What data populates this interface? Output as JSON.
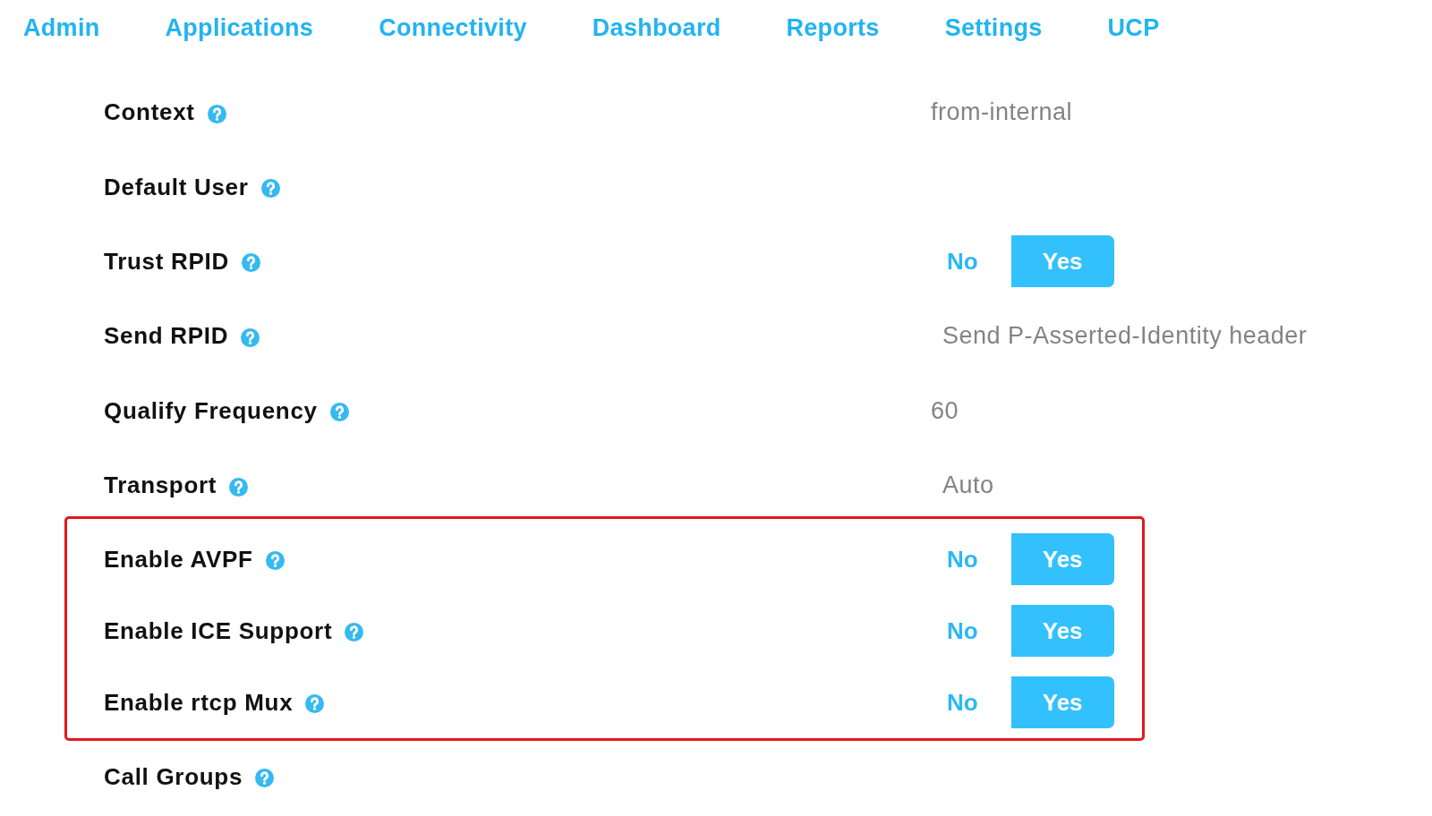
{
  "nav": [
    "Admin",
    "Applications",
    "Connectivity",
    "Dashboard",
    "Reports",
    "Settings",
    "UCP"
  ],
  "groups": [
    {
      "highlighted": false,
      "rows": [
        {
          "label": "Context",
          "kind": "text",
          "value": "from-internal"
        },
        {
          "label": "Default User",
          "kind": "text"
        },
        {
          "label": "Trust RPID",
          "kind": "toggle",
          "options": [
            {
              "label": "No",
              "selected": false
            },
            {
              "label": "Yes",
              "selected": true
            }
          ]
        },
        {
          "label": "Send RPID",
          "kind": "select",
          "value": "Send P-Asserted-Identity header"
        },
        {
          "label": "Qualify Frequency",
          "kind": "text",
          "value": "60"
        },
        {
          "label": "Transport",
          "kind": "select",
          "value": "Auto"
        }
      ]
    },
    {
      "highlighted": true,
      "rows": [
        {
          "label": "Enable AVPF",
          "kind": "toggle",
          "options": [
            {
              "label": "No",
              "selected": false
            },
            {
              "label": "Yes",
              "selected": true
            }
          ]
        },
        {
          "label": "Enable ICE Support",
          "kind": "toggle",
          "options": [
            {
              "label": "No",
              "selected": false
            },
            {
              "label": "Yes",
              "selected": true
            }
          ]
        },
        {
          "label": "Enable rtcp Mux",
          "kind": "toggle",
          "options": [
            {
              "label": "No",
              "selected": false
            },
            {
              "label": "Yes",
              "selected": true
            }
          ]
        }
      ]
    },
    {
      "highlighted": false,
      "rows": [
        {
          "label": "Call Groups",
          "kind": "text"
        }
      ]
    }
  ]
}
